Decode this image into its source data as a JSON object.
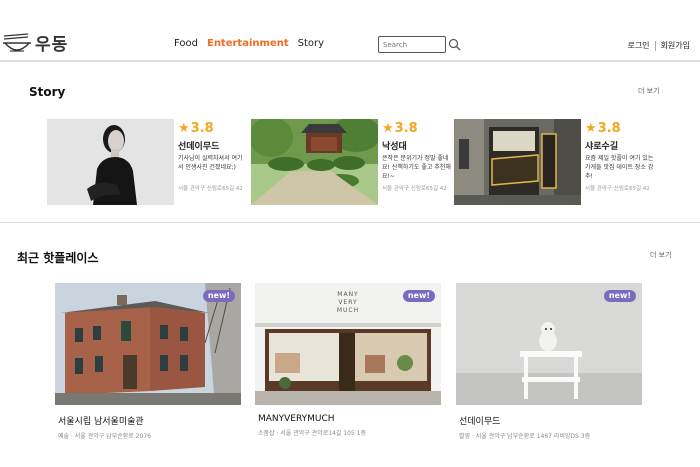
{
  "header": {
    "logo_text": "우동",
    "nav": [
      "Food",
      "Entertainment",
      "Story"
    ],
    "search_placeholder": "Search",
    "login": "로그인",
    "signup": "회원가입"
  },
  "story": {
    "title": "Story",
    "more": "더 보기",
    "cards": [
      {
        "rating": "3.8",
        "name": "선데이무드",
        "desc": "기사님이 실력자셔서 여기서 인생사진 건졌네요:)",
        "addr": "서울 관악구 신림로65길 42"
      },
      {
        "rating": "3.8",
        "name": "낙성대",
        "desc": "은작은 분위기가 정말 좋네요! 산책하기도 좋고 추천해요!~",
        "addr": "서울 관악구 신림로65길 42"
      },
      {
        "rating": "3.8",
        "name": "샤로수길",
        "desc": "요즘 제일 핫플이 여기 있는 가게들 맛집 데이트 장소 강추!",
        "addr": "서울 관악구 신림로65길 42"
      }
    ]
  },
  "hot": {
    "title": "최근 핫플레이스",
    "more": "더 보기",
    "badge": "new!",
    "cards": [
      {
        "name": "서울시립 남서울미술관",
        "meta": "예술 · 서울 관악구 남부순환로 2076"
      },
      {
        "name": "MANYVERYMUCH",
        "meta": "소품샵 · 서울 관악구 관악로14길 105 1층"
      },
      {
        "name": "선데이무드",
        "meta": "촬영 · 서울 관악구 남부순환로 1467 라비앙DS 3층"
      }
    ],
    "sign_text": "MANY VERY MUCH"
  }
}
